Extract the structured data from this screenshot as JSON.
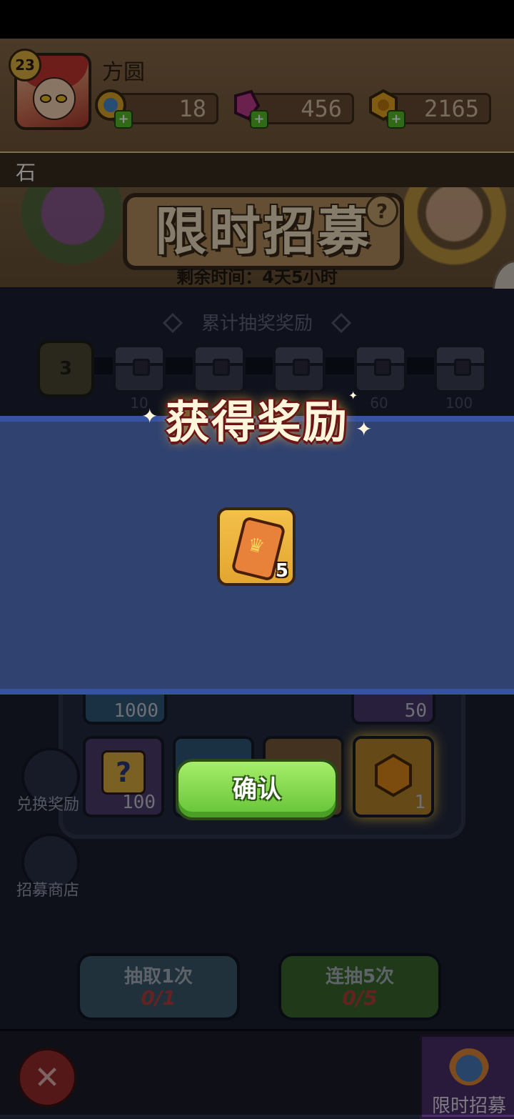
{
  "player": {
    "level": "23",
    "name": "方圆"
  },
  "resources": {
    "blue_gem": "18",
    "purple_crystal": "456",
    "gold_coin": "2165"
  },
  "notice": "石",
  "banner": {
    "title": "限时招募",
    "help": "?",
    "remaining_time": "剩余时间：4天5小时"
  },
  "milestones": {
    "title": "累计抽奖奖励",
    "start_count": "3",
    "chests": [
      "10",
      "",
      "60",
      "100"
    ]
  },
  "grid": {
    "top_counts": [
      "1000",
      "50"
    ],
    "slots": [
      {
        "count": "100"
      },
      {
        "count": ""
      },
      {
        "count": ""
      },
      {
        "count": "1"
      }
    ]
  },
  "side_buttons": {
    "exchange": "兑换奖励",
    "shop": "招募商店"
  },
  "draw": {
    "single_label": "抽取1次",
    "single_count": "0/1",
    "multi_label": "连抽5次",
    "multi_count": "0/5"
  },
  "bottom": {
    "close": "✕",
    "tab_label": "限时招募"
  },
  "reward_dialog": {
    "title": "获得奖励",
    "item_count": "5",
    "confirm_label": "确认"
  },
  "colors": {
    "panel_blue": "#2f4270",
    "confirm_green": "#64c235",
    "header_brown": "#735739"
  }
}
